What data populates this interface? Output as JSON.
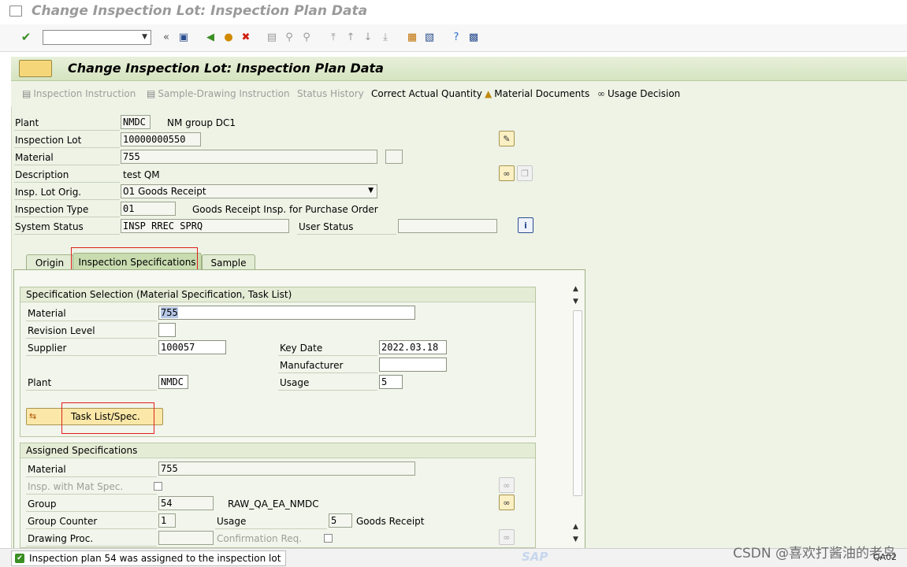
{
  "window": {
    "title": "Change Inspection Lot: Inspection Plan Data"
  },
  "system_toolbar": {
    "command_field_value": "",
    "icons": [
      "enter-icon",
      "back-double-icon",
      "save-icon",
      "back-icon",
      "exit-icon",
      "cancel-icon",
      "print-icon",
      "find-icon",
      "find-next-icon",
      "first-page-icon",
      "prev-page-icon",
      "next-page-icon",
      "last-page-icon",
      "new-session-icon",
      "shortcut-icon",
      "help-icon",
      "customize-layout-icon"
    ]
  },
  "screen": {
    "title": "Change Inspection Lot: Inspection Plan Data"
  },
  "app_toolbar": {
    "inspection_instruction": "Inspection Instruction",
    "sample_drawing_instruction": "Sample-Drawing Instruction",
    "status_history": "Status History",
    "correct_actual_quantity": "Correct Actual Quantity",
    "material_documents": "Material Documents",
    "usage_decision": "Usage Decision"
  },
  "header": {
    "plant_label": "Plant",
    "plant_value": "NMDC",
    "plant_desc": "NM group DC1",
    "lot_label": "Inspection Lot",
    "lot_value": "10000000550",
    "material_label": "Material",
    "material_value": "755",
    "description_label": "Description",
    "description_value": "test QM",
    "origin_label": "Insp. Lot Orig.",
    "origin_value": "01 Goods Receipt",
    "type_label": "Inspection Type",
    "type_value": "01",
    "type_desc": "Goods Receipt Insp. for Purchase Order",
    "sys_status_label": "System Status",
    "sys_status_value": "INSP RREC SPRQ",
    "user_status_label": "User Status",
    "user_status_value": ""
  },
  "tabs": [
    {
      "label": "Origin",
      "active": false
    },
    {
      "label": "Inspection Specifications",
      "active": true
    },
    {
      "label": "Sample",
      "active": false
    }
  ],
  "spec_selection": {
    "title": "Specification Selection (Material Specification, Task List)",
    "material_label": "Material",
    "material_value": "755",
    "revision_label": "Revision Level",
    "revision_value": "",
    "supplier_label": "Supplier",
    "supplier_value": "100057",
    "key_date_label": "Key Date",
    "key_date_value": "2022.03.18",
    "manufacturer_label": "Manufacturer",
    "manufacturer_value": "",
    "plant_label": "Plant",
    "plant_value": "NMDC",
    "usage_label": "Usage",
    "usage_value": "5",
    "task_list_button": "Task List/Spec."
  },
  "assigned_specs": {
    "title": "Assigned Specifications",
    "material_label": "Material",
    "material_value": "755",
    "mat_spec_label": "Insp. with Mat Spec.",
    "group_label": "Group",
    "group_value": "54",
    "group_desc": "RAW_QA_EA_NMDC",
    "counter_label": "Group Counter",
    "counter_value": "1",
    "usage_label": "Usage",
    "usage_value": "5",
    "usage_desc": "Goods Receipt",
    "drawing_label": "Drawing Proc.",
    "drawing_value": "",
    "confirm_label": "Confirmation Req."
  },
  "status_bar": {
    "message": "Inspection plan 54 was assigned to the inspection lot",
    "system": "QA02"
  },
  "branding": {
    "sap": "SAP",
    "watermark": "CSDN @喜欢打酱油的老鸟"
  },
  "colors": {
    "accent_green": "#d5e4c0",
    "highlight_red": "#e0201c",
    "success_green": "#3a8e24"
  }
}
